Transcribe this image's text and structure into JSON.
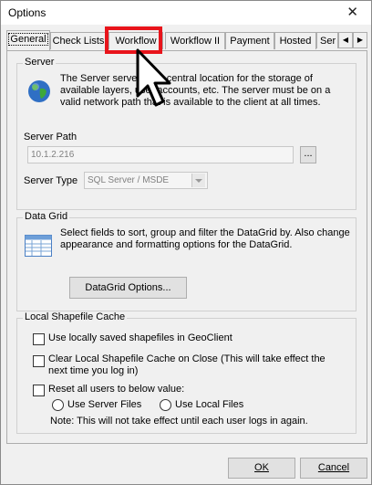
{
  "window": {
    "title": "Options",
    "close_glyph": "✕"
  },
  "tabs": [
    {
      "label": "General",
      "active": true
    },
    {
      "label": "Check Lists"
    },
    {
      "label": "Workflow"
    },
    {
      "label": "Workflow II"
    },
    {
      "label": "Payment"
    },
    {
      "label": "Hosted"
    },
    {
      "label": "Ser"
    }
  ],
  "tab_scroll": {
    "left": "◀",
    "right": "▶"
  },
  "server": {
    "group_label": "Server",
    "description": "The Server serves as a central location for the storage of available layers, user accounts, etc. The server must be on a valid network path that is available to the client at all times.",
    "path_label": "Server Path",
    "path_value": "10.1.2.216",
    "browse_label": "...",
    "type_label": "Server Type",
    "type_value": "SQL Server / MSDE"
  },
  "datagrid": {
    "group_label": "Data Grid",
    "description": "Select fields to sort, group and filter the DataGrid by. Also change appearance and formatting options for the DataGrid.",
    "button_label": "DataGrid Options..."
  },
  "shapefile": {
    "group_label": "Local Shapefile Cache",
    "use_local_label": "Use locally saved shapefiles in GeoClient",
    "clear_cache_label": "Clear Local Shapefile Cache on Close (This will take effect the next time you log in)",
    "reset_label": "Reset all users to below value:",
    "radio_server": "Use Server Files",
    "radio_local": "Use Local Files",
    "note": "Note: This will not take effect until each user logs in again."
  },
  "footer": {
    "ok_label": "OK",
    "cancel_label": "Cancel"
  },
  "colors": {
    "highlight": "#e8141b",
    "dialog_bg": "#f0f0f0"
  },
  "icons": [
    "globe-icon",
    "grid-icon",
    "dropdown-arrow-icon",
    "pointer-cursor-icon"
  ]
}
